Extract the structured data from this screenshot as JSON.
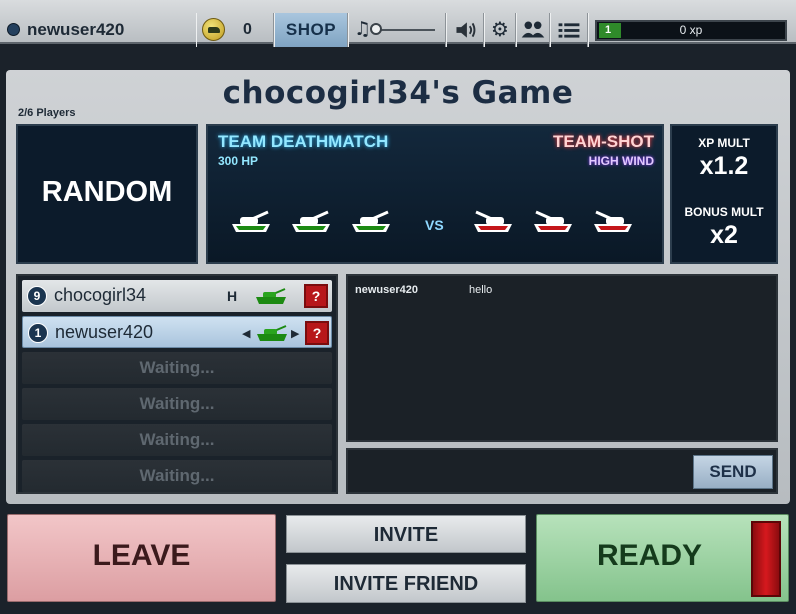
{
  "topbar": {
    "username": "newuser420",
    "coins": "0",
    "shop_label": "SHOP",
    "music_icon": "music-note-icon",
    "sound_icon": "speaker-icon",
    "settings_icon": "gear-icon",
    "friends_icon": "people-icon",
    "menu_icon": "list-icon",
    "xp_level": "1",
    "xp_text": "0 xp"
  },
  "game": {
    "title": "chocogirl34's Game",
    "players_count": "2/6 Players",
    "map": "RANDOM",
    "mode": "TEAM DEATHMATCH",
    "hp": "300 HP",
    "weapon": "TEAM-SHOT",
    "wind": "HIGH WIND",
    "vs": "VS",
    "xp_mult_label": "XP MULT",
    "xp_mult": "x1.2",
    "bonus_mult_label": "BONUS MULT",
    "bonus_mult": "x2"
  },
  "players": [
    {
      "level": "9",
      "name": "chocogirl34",
      "tag": "H",
      "help": "?"
    },
    {
      "level": "1",
      "name": "newuser420",
      "help": "?"
    }
  ],
  "waiting": [
    "Waiting...",
    "Waiting...",
    "Waiting...",
    "Waiting..."
  ],
  "chat": {
    "user": "newuser420",
    "message": "hello",
    "send_label": "SEND"
  },
  "actions": {
    "leave": "LEAVE",
    "invite": "INVITE",
    "invite_friend": "INVITE FRIEND",
    "ready": "READY"
  },
  "colors": {
    "team_green": "#1c8a12",
    "team_red": "#c4161a"
  }
}
